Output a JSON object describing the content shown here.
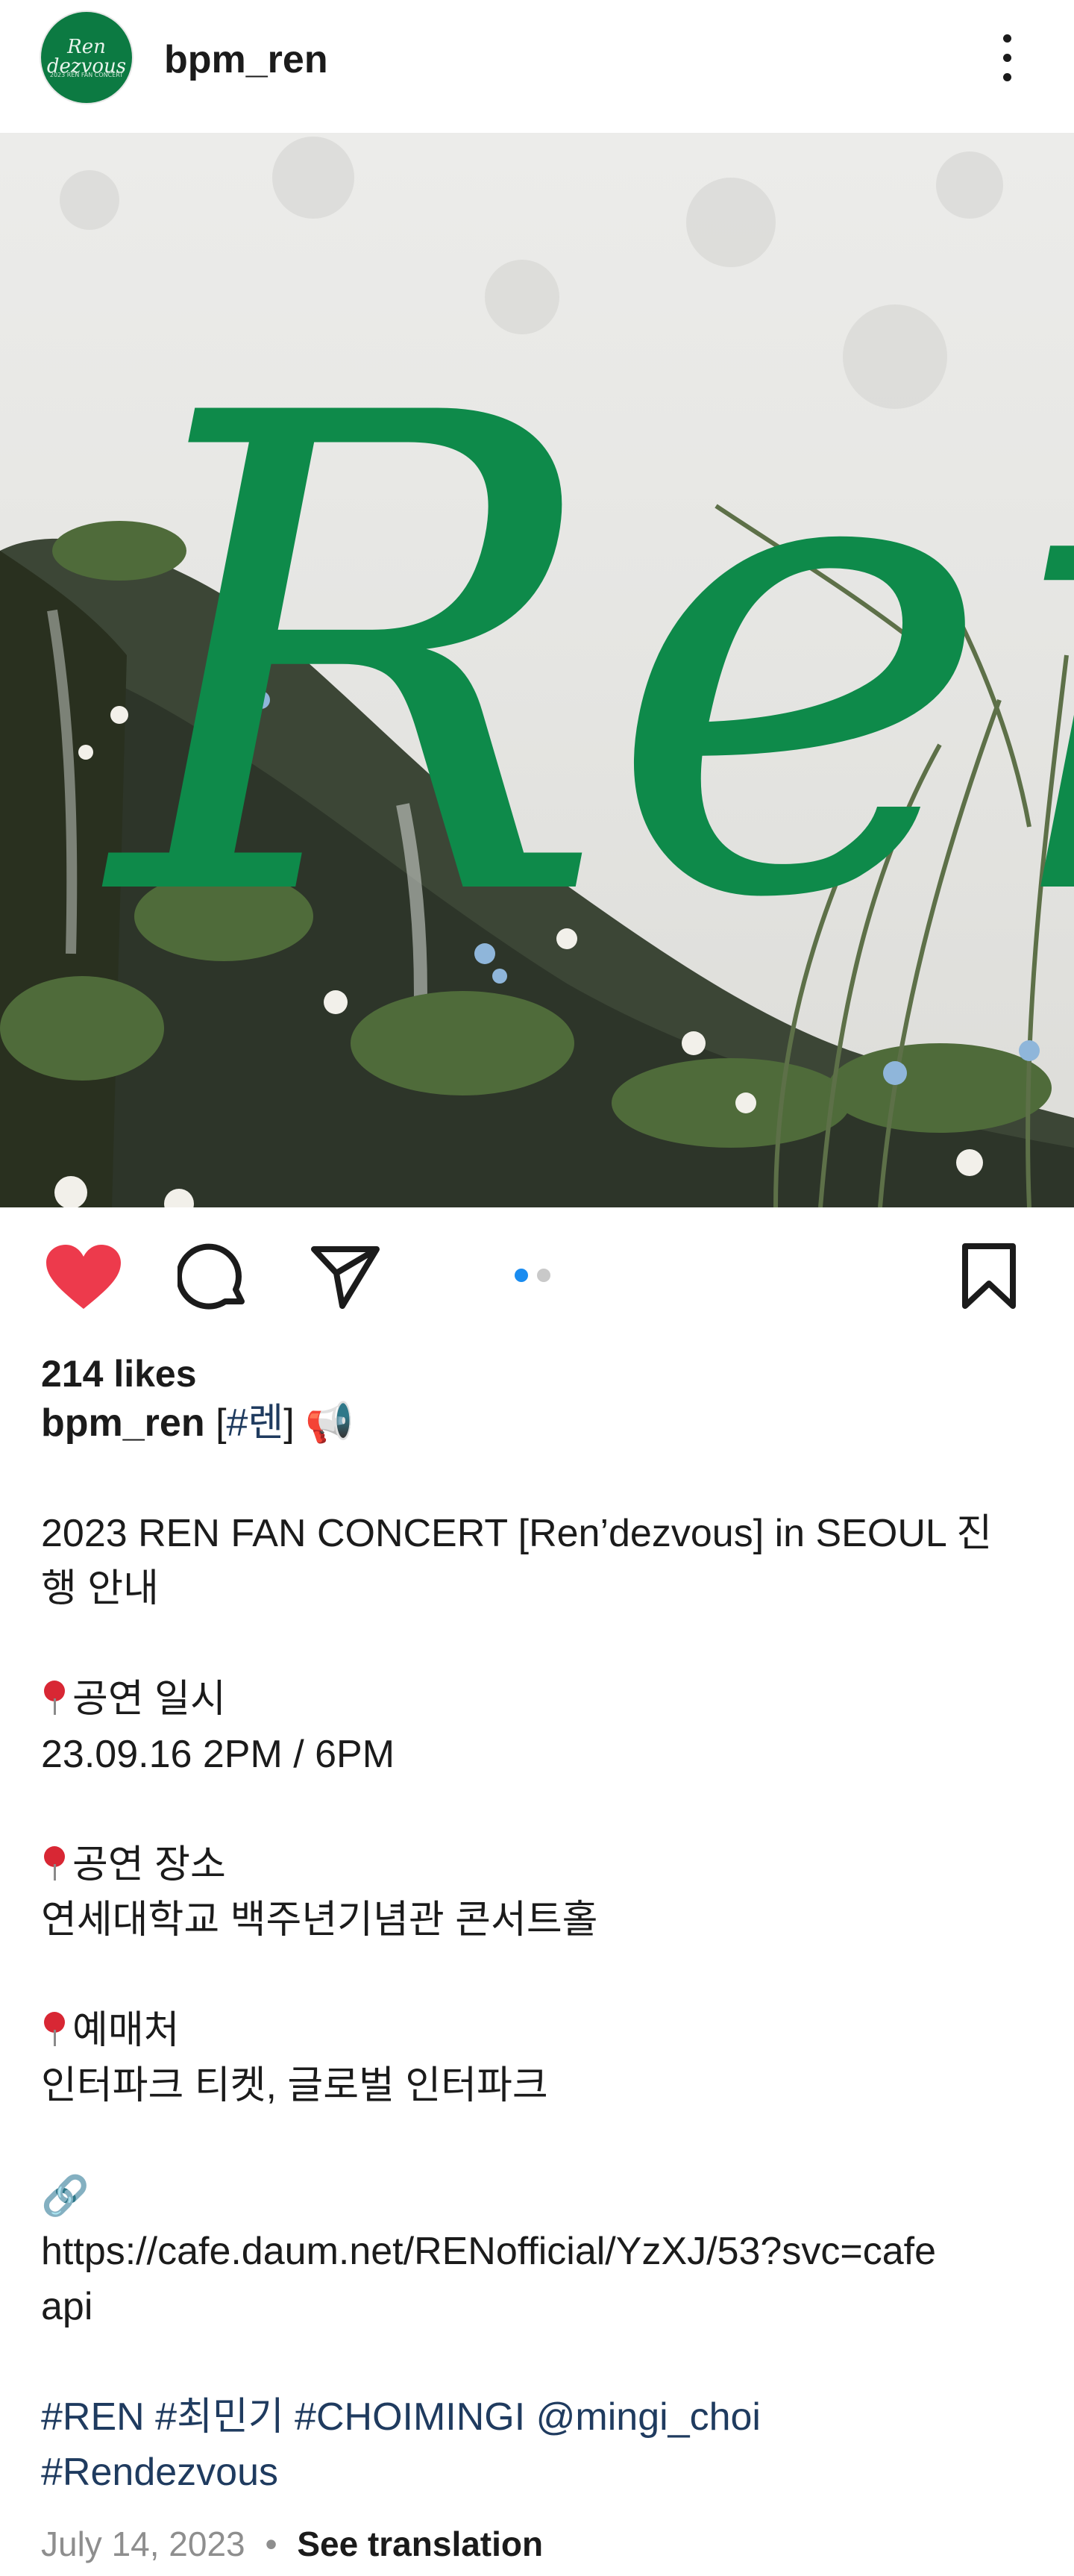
{
  "header": {
    "username": "bpm_ren",
    "avatar_text": "Ren dezvous",
    "avatar_subtext": "2023 REN FAN CONCERT"
  },
  "post": {
    "image_wordmark": "Ren",
    "slide_count": 2,
    "active_slide": 1
  },
  "actions": {
    "liked": true
  },
  "likes_text": "214 likes",
  "caption": {
    "author": "bpm_ren",
    "hashtag_open": "[",
    "hashtag": "#렌",
    "hashtag_close": "]",
    "megaphone": "📢",
    "title_line1": "2023 REN FAN CONCERT [Ren’dezvous] in SEOUL 진",
    "title_line2": "행 안내",
    "date_heading": "공연 일시",
    "date_value": "23.09.16 2PM / 6PM",
    "venue_heading": "공연 장소",
    "venue_value": "연세대학교 백주년기념관 콘서트홀",
    "ticket_heading": "예매처",
    "ticket_value": "인터파크 티켓, 글로벌 인터파크",
    "link_icon": "🔗",
    "url_line1": "https://cafe.daum.net/RENofficial/YzXJ/53?svc=cafe",
    "url_line2": "api",
    "tags_line1": "#REN #최민기 #CHOIMINGI @mingi_choi",
    "tags_line2": "#Rendezvous"
  },
  "footer": {
    "date": "July 14, 2023",
    "separator": "•",
    "translate_label": "See translation"
  },
  "colors": {
    "heart": "#ed3a4c",
    "brand_green": "#0e8a4a",
    "active_dot": "#1a8cf0",
    "inactive_dot": "#c9c9c9",
    "link": "#1f3b5f"
  }
}
